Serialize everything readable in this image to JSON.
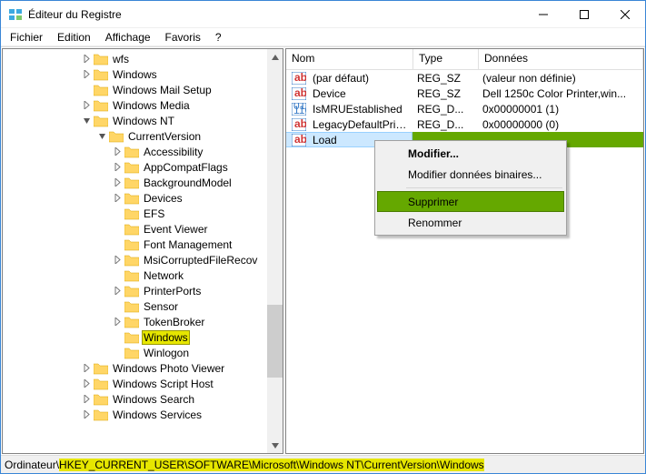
{
  "title": "Éditeur du Registre",
  "menu": [
    "Fichier",
    "Edition",
    "Affichage",
    "Favoris",
    "?"
  ],
  "tree": [
    {
      "indent": 5,
      "exp": ">",
      "label": "wfs"
    },
    {
      "indent": 5,
      "exp": ">",
      "label": "Windows"
    },
    {
      "indent": 5,
      "exp": "",
      "label": "Windows Mail Setup"
    },
    {
      "indent": 5,
      "exp": ">",
      "label": "Windows Media"
    },
    {
      "indent": 5,
      "exp": "v",
      "label": "Windows NT"
    },
    {
      "indent": 6,
      "exp": "v",
      "label": "CurrentVersion"
    },
    {
      "indent": 7,
      "exp": ">",
      "label": "Accessibility"
    },
    {
      "indent": 7,
      "exp": ">",
      "label": "AppCompatFlags"
    },
    {
      "indent": 7,
      "exp": ">",
      "label": "BackgroundModel"
    },
    {
      "indent": 7,
      "exp": ">",
      "label": "Devices"
    },
    {
      "indent": 7,
      "exp": "",
      "label": "EFS"
    },
    {
      "indent": 7,
      "exp": "",
      "label": "Event Viewer"
    },
    {
      "indent": 7,
      "exp": "",
      "label": "Font Management"
    },
    {
      "indent": 7,
      "exp": ">",
      "label": "MsiCorruptedFileRecov"
    },
    {
      "indent": 7,
      "exp": "",
      "label": "Network"
    },
    {
      "indent": 7,
      "exp": ">",
      "label": "PrinterPorts"
    },
    {
      "indent": 7,
      "exp": "",
      "label": "Sensor"
    },
    {
      "indent": 7,
      "exp": ">",
      "label": "TokenBroker"
    },
    {
      "indent": 7,
      "exp": "",
      "label": "Windows",
      "hl": true
    },
    {
      "indent": 7,
      "exp": "",
      "label": "Winlogon"
    },
    {
      "indent": 5,
      "exp": ">",
      "label": "Windows Photo Viewer"
    },
    {
      "indent": 5,
      "exp": ">",
      "label": "Windows Script Host"
    },
    {
      "indent": 5,
      "exp": ">",
      "label": "Windows Search"
    },
    {
      "indent": 5,
      "exp": ">",
      "label": "Windows Services"
    }
  ],
  "cols": [
    {
      "label": "Nom",
      "w": 140
    },
    {
      "label": "Type",
      "w": 72
    },
    {
      "label": "Données",
      "w": 180
    }
  ],
  "rows": [
    {
      "icon": "str",
      "name": "(par défaut)",
      "type": "REG_SZ",
      "data": "(valeur non définie)"
    },
    {
      "icon": "str",
      "name": "Device",
      "type": "REG_SZ",
      "data": "Dell 1250c Color Printer,win..."
    },
    {
      "icon": "bin",
      "name": "IsMRUEstablished",
      "type": "REG_D...",
      "data": "0x00000001 (1)"
    },
    {
      "icon": "str",
      "name": "LegacyDefaultPrint...",
      "type": "REG_D...",
      "data": "0x00000000 (0)"
    },
    {
      "icon": "str",
      "name": "Load",
      "type": "",
      "data": "",
      "sel": true
    }
  ],
  "ctx": {
    "items": [
      "Modifier...",
      "Modifier données binaires...",
      "Supprimer",
      "Renommer"
    ],
    "bold": 0,
    "sel": 2
  },
  "status": {
    "prefix": "Ordinateur\\",
    "path": "HKEY_CURRENT_USER\\SOFTWARE\\Microsoft\\Windows NT\\CurrentVersion\\Windows"
  }
}
